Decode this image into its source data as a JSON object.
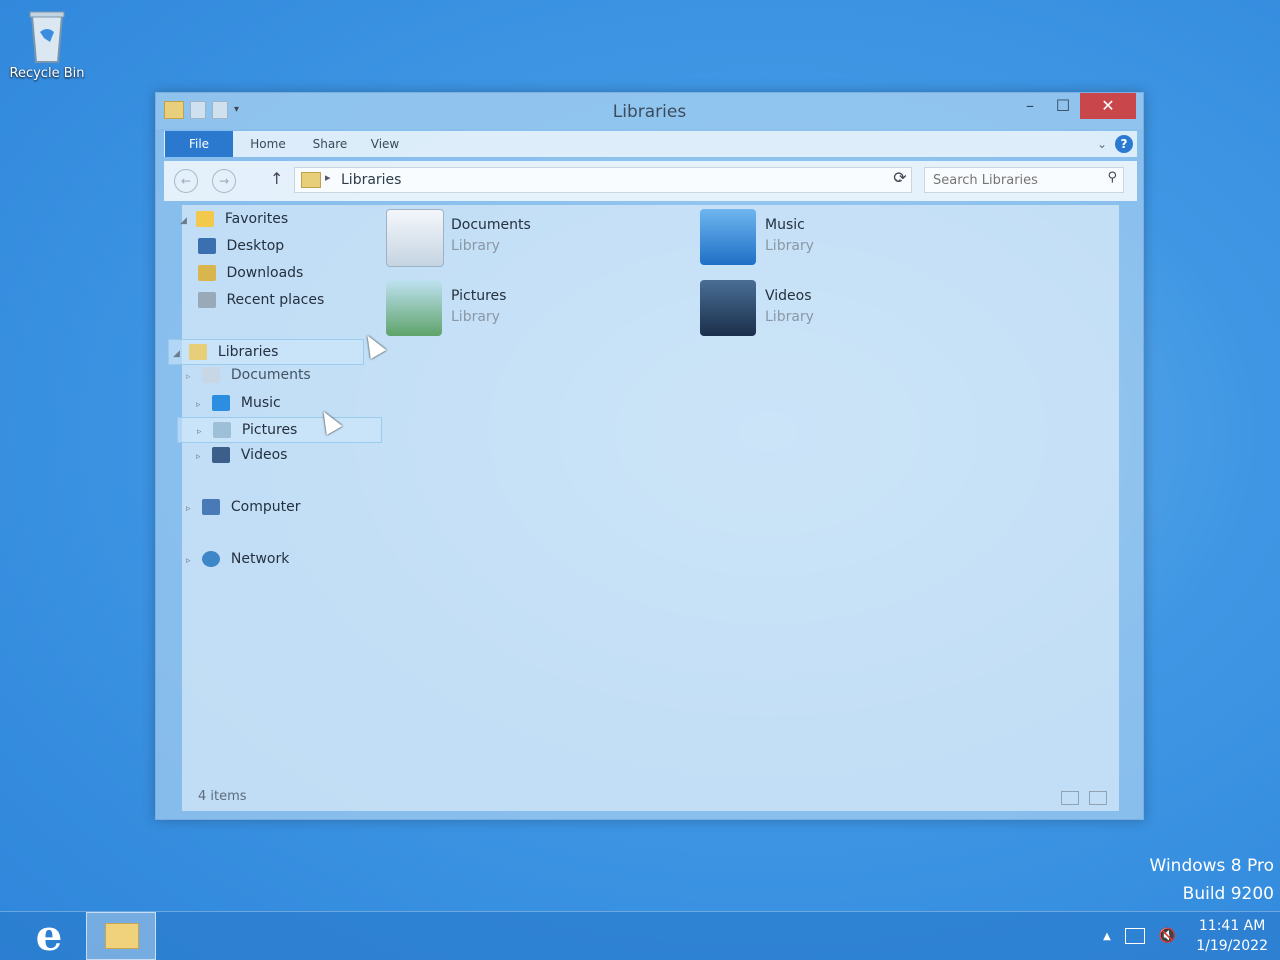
{
  "desktop": {
    "recycle_bin_label": "Recycle Bin",
    "watermark_line1": "Windows 8 Pro",
    "watermark_line2": "Build 9200"
  },
  "window": {
    "title": "Libraries",
    "ribbon_tabs": [
      "File",
      "Home",
      "Share",
      "View"
    ],
    "address_path": "Libraries",
    "search_placeholder": "Search Libraries",
    "status_text": "4 items"
  },
  "nav_tree": {
    "favorites_label": "Favorites",
    "favorites": [
      "Desktop",
      "Downloads",
      "Recent places"
    ],
    "libraries_label": "Libraries",
    "libraries": [
      "Documents",
      "Music",
      "Pictures",
      "Videos"
    ],
    "computer_label": "Computer",
    "network_label": "Network"
  },
  "library_items": [
    {
      "name": "Documents",
      "type": "Library",
      "icon": "documents-icon"
    },
    {
      "name": "Music",
      "type": "Library",
      "icon": "music-icon"
    },
    {
      "name": "Pictures",
      "type": "Library",
      "icon": "pictures-icon"
    },
    {
      "name": "Videos",
      "type": "Library",
      "icon": "videos-icon"
    }
  ],
  "taskbar": {
    "time": "11:41 AM",
    "date": "1/19/2022"
  },
  "colors": {
    "accent": "#2b79cf",
    "close_button": "#c9474b"
  }
}
